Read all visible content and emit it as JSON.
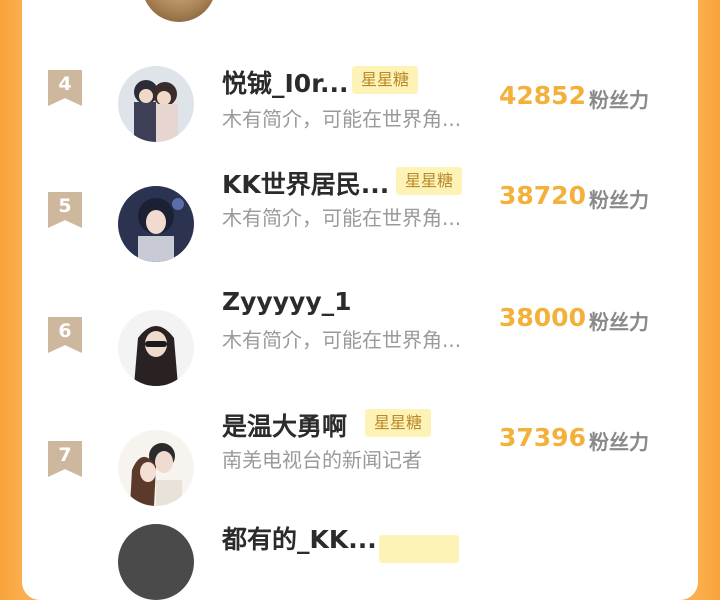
{
  "leaderboard": {
    "rows": [
      {
        "rank": "4",
        "name": "悦铖_I0r...",
        "badge": "星星糖",
        "bio": "木有简介，可能在世界角...",
        "score": "42852",
        "score_label": "粉丝力"
      },
      {
        "rank": "5",
        "name": "KK世界居民...",
        "badge": "星星糖",
        "bio": "木有简介，可能在世界角...",
        "score": "38720",
        "score_label": "粉丝力"
      },
      {
        "rank": "6",
        "name": "Zyyyyy_1",
        "badge": "",
        "bio": "木有简介，可能在世界角...",
        "score": "38000",
        "score_label": "粉丝力"
      },
      {
        "rank": "7",
        "name": "是温大勇啊",
        "badge": "星星糖",
        "bio": "南羌电视台的新闻记者",
        "score": "37396",
        "score_label": "粉丝力"
      }
    ],
    "peek_name": "都有的_KK..."
  },
  "colors": {
    "background": "#fbb04d",
    "score": "#f3b03a",
    "badge_bg": "#fdf3b7",
    "badge_text": "#b9892a",
    "rank_ribbon": "#cdb79d"
  }
}
